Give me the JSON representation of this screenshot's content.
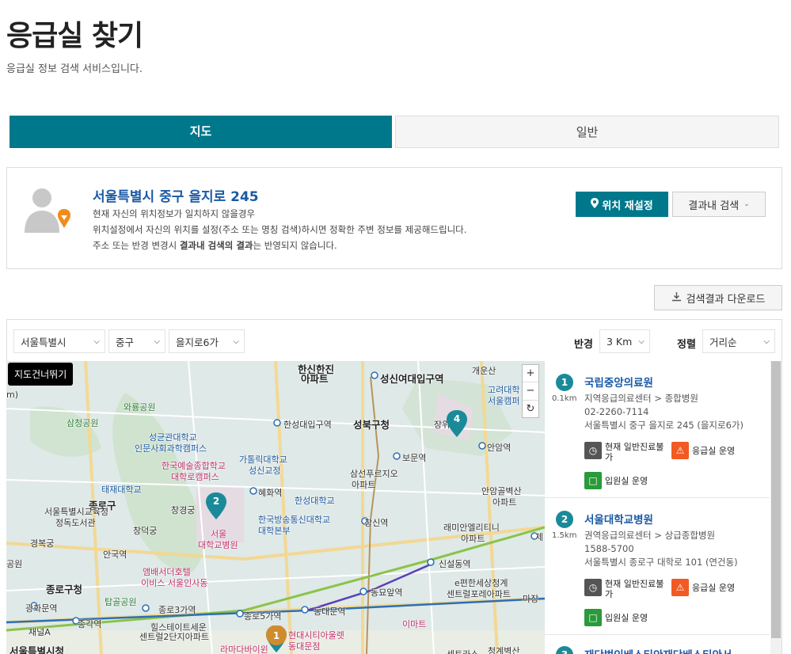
{
  "page": {
    "title": "응급실 찾기",
    "description": "응급실 정보 검색 서비스입니다."
  },
  "tabs": [
    {
      "label": "지도",
      "active": true
    },
    {
      "label": "일반",
      "active": false
    }
  ],
  "location": {
    "address": "서울특별시 중구 을지로 245",
    "line1": "현재 자신의 위치정보가 일치하지 않을경우",
    "line2": "위치설정에서 자신의 위치를 설정(주소 또는 명칭 검색)하시면 정확한 주변 정보를 제공해드립니다.",
    "line3_pre": "주소 또는 반경 변경시 ",
    "line3_bold": "결과내 검색의 결과",
    "line3_post": "는 반영되지 않습니다.",
    "reset_button": "위치 재설정",
    "in_result_button": "결과내 검색"
  },
  "download_button": "검색결과 다운로드",
  "filters": {
    "city": "서울특별시",
    "district": "중구",
    "dong": "을지로6가",
    "radius_label": "반경",
    "radius_value": "3 Km",
    "sort_label": "정렬",
    "sort_value": "거리순"
  },
  "map": {
    "skip_button": "지도건너뛰기",
    "zoom_in": "+",
    "zoom_out": "−",
    "reset": "↻",
    "labels": {
      "l1": "한신한진",
      "l2": "아파트",
      "l3": "성신여대입구역",
      "l4": "개운산",
      "l5": "고려대학",
      "l6": "서울캠퍼",
      "l7": "와룡공원",
      "l8": "삼청공원",
      "l9": "성균관대학교",
      "l10": "인문사회과학캠퍼스",
      "l11": "한성대입구역",
      "l12": "성북구청",
      "l13": "장위",
      "l14": "안암역",
      "l15": "한국예술종합학교",
      "l16": "대학로캠퍼스",
      "l17": "가톨릭대학교",
      "l18": "성신교정",
      "l19": "보문역",
      "l20": "삼선푸르지오",
      "l21": "아파트",
      "l22": "안암골벽산",
      "l23": "아파트",
      "l24": "태재대학교",
      "l25": "종로구",
      "l26": "창경궁",
      "l27": "혜화역",
      "l28": "한성대학교",
      "l29": "서울특별시교육청",
      "l30": "정독도서관",
      "l31": "창덕궁",
      "l32": "서울",
      "l33": "대학교병원",
      "l34": "한국방송통신대학교",
      "l35": "대학본부",
      "l36": "창신역",
      "l37": "래미안엘리티니",
      "l38": "아파트",
      "l39": "경복궁",
      "l40": "안국역",
      "l41": "앰배서더호텔",
      "l42": "이비스 서울인사동",
      "l43": "신설동역",
      "l44": "e편한세상청계",
      "l45": "센트럴포레아파트",
      "l46": "종로구청",
      "l47": "탑골공원",
      "l48": "동묘앞역",
      "l49": "광화문역",
      "l50": "종로3가역",
      "l51": "종로5가역",
      "l52": "동대문역",
      "l53": "종각역",
      "l54": "이마트",
      "l55": "채널A",
      "l56": "힐스테이트세운",
      "l57": "센트럴2단지아파트",
      "l58": "현대시티아울렛",
      "l59": "동대문점",
      "l60": "서울특별시청",
      "l61": "라마다바이윈",
      "l62": "청계벽산",
      "l63": "센트라스",
      "l64": "제",
      "l65": "공원",
      "l66": "m)",
      "l67": "마장"
    },
    "markers": [
      "1",
      "2",
      "4"
    ]
  },
  "hospitals": [
    {
      "num": "1",
      "distance": "0.1km",
      "name": "국립중앙의료원",
      "type": "지역응급의료센터 > 종합병원",
      "phone": "02-2260-7114",
      "address": "서울특별시 중구 을지로 245 (을지로6가)",
      "badge_general": "현재 일반진료불가",
      "badge_er": "응급실 운영",
      "badge_ward": "입원실 운영"
    },
    {
      "num": "2",
      "distance": "1.5km",
      "name": "서울대학교병원",
      "type": "권역응급의료센터 > 상급종합병원",
      "phone": "1588-5700",
      "address": "서울특별시 종로구 대학로 101 (연건동)",
      "badge_general": "현재 일반진료불가",
      "badge_er": "응급실 운영",
      "badge_ward": "입원실 운영"
    },
    {
      "num": "3",
      "name": "재단법인베스티안재단베스티안서"
    }
  ],
  "colors": {
    "primary": "#00788c",
    "link": "#1a5aa6",
    "marker_teal": "#1a8a99",
    "marker_orange": "#f08c1a",
    "er_orange": "#f15a22",
    "ward_green": "#2a9a3a"
  }
}
